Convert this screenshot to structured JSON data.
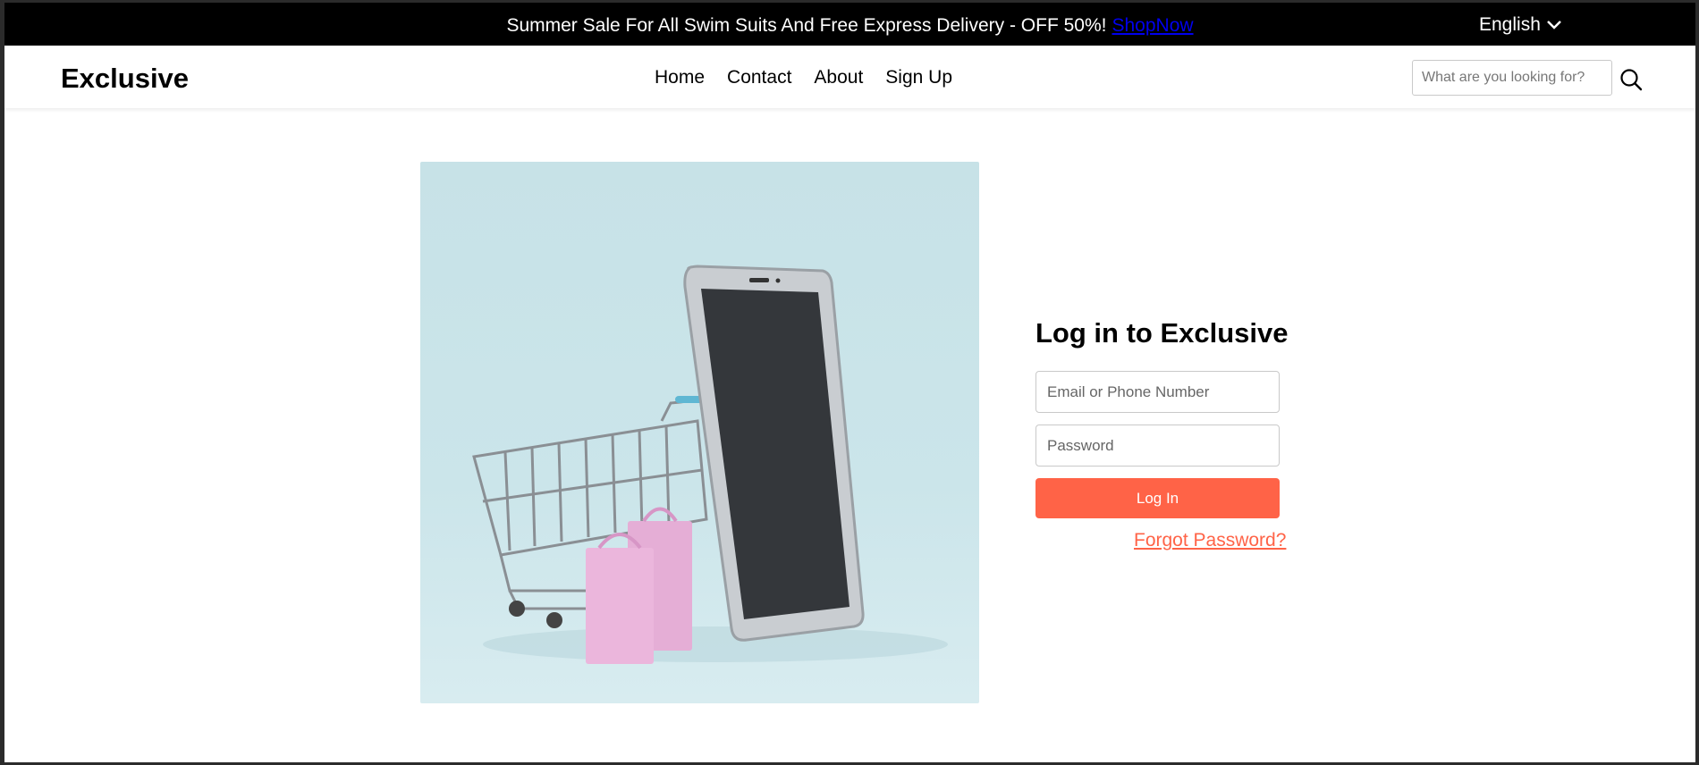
{
  "announcement": {
    "text": "Summer Sale For All Swim Suits And Free Express Delivery - OFF 50%!",
    "link": "ShopNow"
  },
  "language": {
    "selected": "English",
    "icon": "chevron-down-icon"
  },
  "header": {
    "logo": "Exclusive",
    "nav": [
      "Home",
      "Contact",
      "About",
      "Sign Up"
    ],
    "search": {
      "placeholder": "What are you looking for?",
      "value": "",
      "icon": "search-icon"
    }
  },
  "hero": {
    "image": "shopping-cart-smartphone-illustration"
  },
  "login": {
    "title": "Log in to Exclusive",
    "email_placeholder": "Email or Phone Number",
    "password_placeholder": "Password",
    "submit_label": "Log In",
    "forgot_label": "Forgot Password?"
  },
  "colors": {
    "accent": "#ff6347",
    "topbar": "#000000",
    "hero_bg": "#c7e2e7"
  }
}
